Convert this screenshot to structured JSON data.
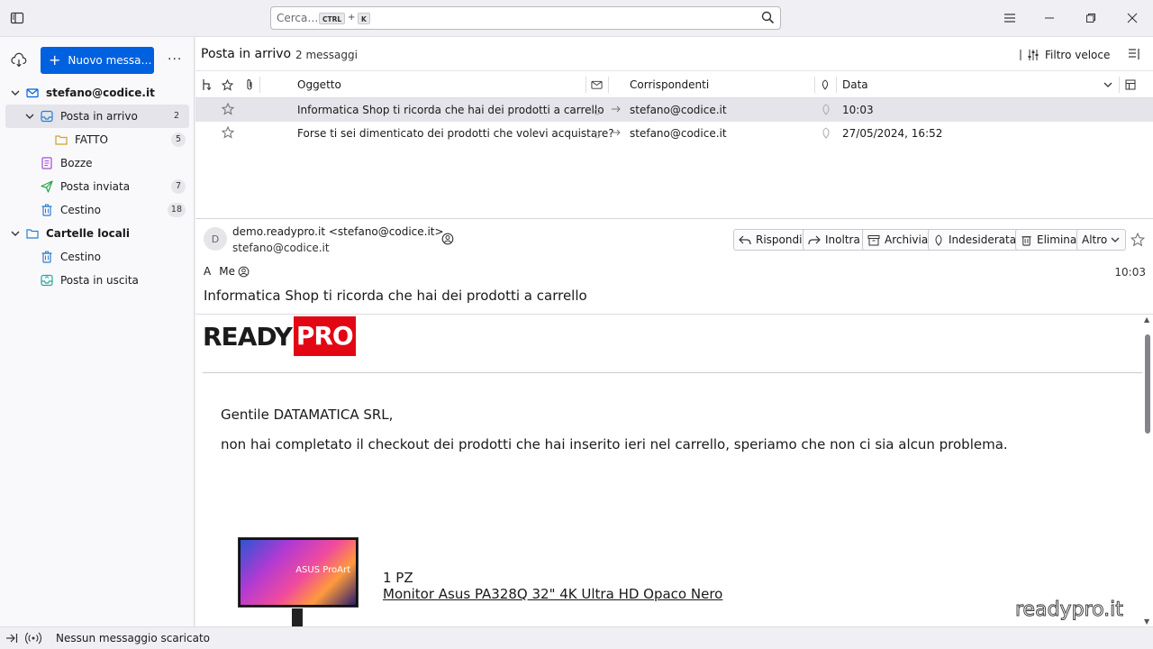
{
  "search": {
    "placeholder": "Cerca…",
    "key1": "CTRL",
    "plus": "+",
    "key2": "K"
  },
  "toolbar": {
    "new_message": "Nuovo messa…",
    "more": "···"
  },
  "folders": [
    {
      "label": "stefano@codice.it",
      "bold": true,
      "badge": ""
    },
    {
      "label": "Posta in arrivo",
      "badge": "2"
    },
    {
      "label": "FATTO",
      "badge": "5"
    },
    {
      "label": "Bozze",
      "badge": ""
    },
    {
      "label": "Posta inviata",
      "badge": "7"
    },
    {
      "label": "Cestino",
      "badge": "18"
    },
    {
      "label": "Cartelle locali",
      "bold": true,
      "badge": ""
    },
    {
      "label": "Cestino",
      "badge": ""
    },
    {
      "label": "Posta in uscita",
      "badge": ""
    }
  ],
  "thread_header": {
    "title": "Posta in arrivo",
    "count": "2 messaggi",
    "quick_filter": "Filtro veloce"
  },
  "columns": {
    "subject": "Oggetto",
    "correspondents": "Corrispondenti",
    "date": "Data"
  },
  "messages": [
    {
      "subject": "Informatica Shop ti ricorda che hai dei prodotti a carrello",
      "correspondent": "stefano@codice.it",
      "date": "10:03"
    },
    {
      "subject": "Forse ti sei dimenticato dei prodotti che volevi acquistare?",
      "correspondent": "stefano@codice.it",
      "date": "27/05/2024, 16:52"
    }
  ],
  "message": {
    "avatar": "D",
    "from": "demo.readypro.it <stefano@codice.it>",
    "from_address": "stefano@codice.it",
    "to_prefix": "A",
    "to": "Me",
    "time": "10:03",
    "subject": "Informatica Shop ti ricorda che hai dei prodotti a carrello",
    "buttons": {
      "reply": "Rispondi",
      "forward": "Inoltra",
      "archive": "Archivia",
      "junk": "Indesiderata",
      "delete": "Elimina",
      "more": "Altro"
    }
  },
  "email_body": {
    "logo_ready": "READY",
    "logo_pro": "PRO",
    "greeting": "Gentile DATAMATICA SRL,",
    "paragraph": "non hai completato il checkout dei prodotti che hai inserito ieri nel carrello, speriamo che non ci sia alcun problema.",
    "product_brand": "ASUS ProArt",
    "quantity": "1 PZ",
    "product_name": "Monitor Asus PA328Q 32\" 4K Ultra HD Opaco Nero",
    "watermark": "readypro.it"
  },
  "status": {
    "text": "Nessun messaggio scaricato"
  },
  "colors": {
    "accent": "#0061e0",
    "brand_red": "#e30613",
    "selected": "#e4e4ea"
  }
}
